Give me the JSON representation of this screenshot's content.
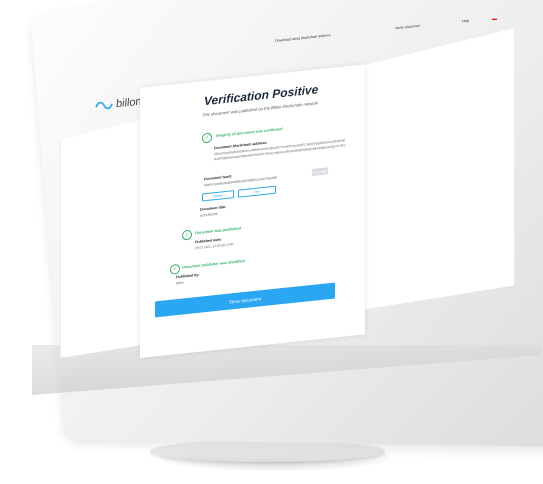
{
  "topbar": {
    "download_link": "Download using blockchain address",
    "verify_link": "Verify document",
    "help_link": "Help",
    "language_icon": "flag-icon"
  },
  "logo": {
    "text": "billon",
    "icon": "billon-logo-icon",
    "color": "#34a9e8"
  },
  "card": {
    "title": "Verification Positive",
    "subtitle": "This document was published on the Billon blockchain network",
    "integrity_status": "Integrity of document was confirmed",
    "blockchain_label": "Document blockchain address:",
    "blockchain_value": "5DbdXnxdr9ehrdSDkDmsAB8WrunMxSBuyXiTVmGfNYuyAIDECAnhEHjQ69cNsSxDF9ctNhAntrP5bpWixmgbZM8emR7NXlJkSY9msLmkpGsvBVsaWKqbmRNqmkPvkhgbmnPjQ75TEG",
    "hash_label": "Document hash:",
    "hash_value": "6ba9ccaeb6ba84864b98f24a59f85bfc1641f7fab090",
    "save_button": "Save hash",
    "details_button": "Details",
    "view_button": "View",
    "doc_title_label": "Document title:",
    "doc_title_value": "eZP1BE2BD",
    "published_status": "Document was published",
    "published_date_label": "Published date:",
    "published_date_value": "29.07.2021, 12:00:02.3 PM",
    "identified_status": "Document publisher was identified",
    "published_by_label": "Published by:",
    "published_by_value": "Billon",
    "show_button": "Show document",
    "accent_color": "#2aa6f2",
    "success_color": "#2fb36b"
  }
}
